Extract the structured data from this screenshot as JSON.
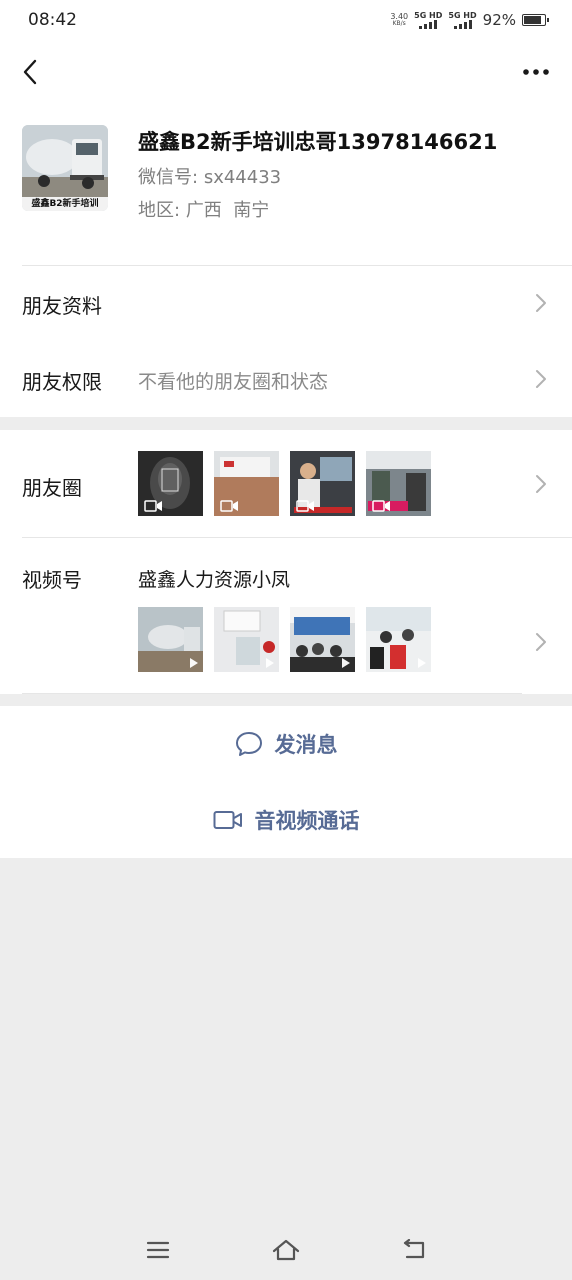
{
  "status_bar": {
    "time": "08:42",
    "net_speed_value": "3.40",
    "net_speed_unit": "KB/s",
    "sim1_label": "5G HD",
    "sim2_label": "5G HD",
    "battery_percent": "92%",
    "battery_level": 0.92
  },
  "nav": {
    "back_icon": "chevron-left-icon",
    "more_icon": "more-dots-icon"
  },
  "profile": {
    "avatar_caption": "盛鑫B2新手培训",
    "name": "盛鑫B2新手培训忠哥13978146621",
    "wechat_id_label": "微信号:",
    "wechat_id": "sx44433",
    "region_label": "地区:",
    "region": "广西  南宁"
  },
  "rows": {
    "friend_profile": {
      "label": "朋友资料"
    },
    "friend_permissions": {
      "label": "朋友权限",
      "value": "不看他的朋友圈和状态"
    },
    "moments": {
      "label": "朋友圈"
    },
    "channels": {
      "label": "视频号",
      "value": "盛鑫人力资源小凤"
    }
  },
  "actions": {
    "send_message": {
      "label": "发消息",
      "icon": "chat-bubble-icon"
    },
    "av_call": {
      "label": "音视频通话",
      "icon": "video-camera-icon"
    }
  },
  "colors": {
    "link_blue": "#576b95",
    "page_bg": "#ededed",
    "text_gray": "#7f7f7f"
  }
}
